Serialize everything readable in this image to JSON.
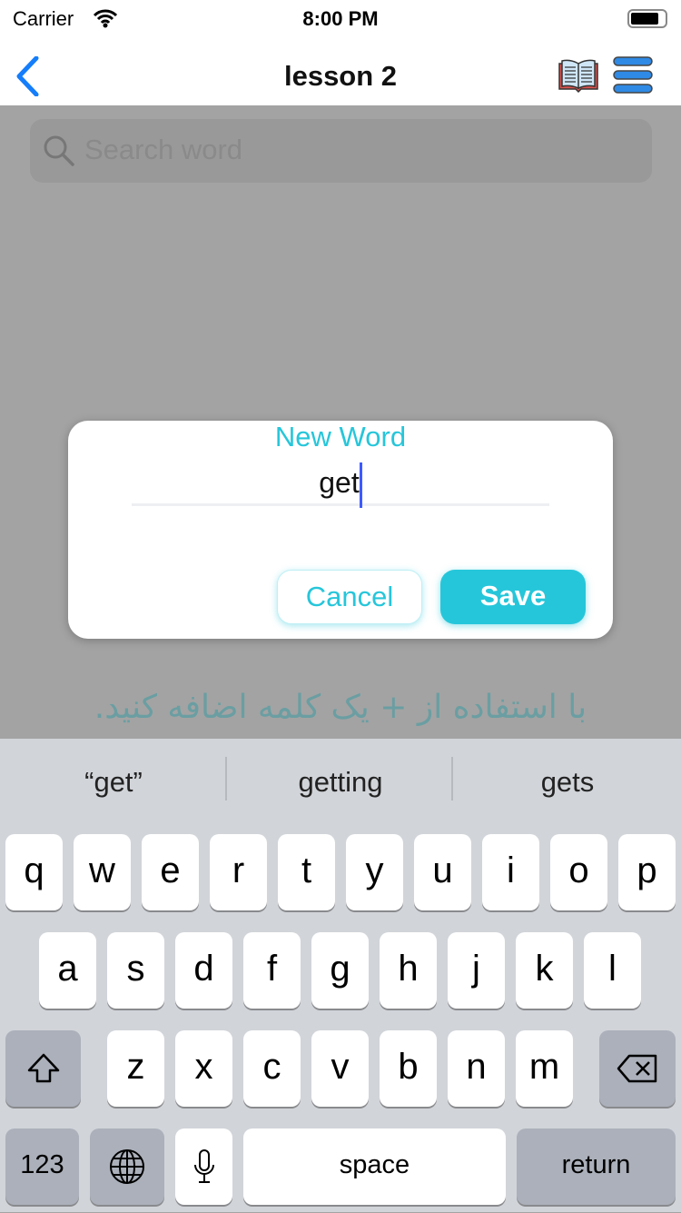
{
  "status": {
    "carrier": "Carrier",
    "time": "8:00 PM"
  },
  "nav": {
    "title": "lesson 2",
    "back_icon": "chevron-left-icon",
    "book_icon": "open-book-icon",
    "menu_icon": "hamburger-menu-icon"
  },
  "search": {
    "placeholder": "Search word"
  },
  "dialog": {
    "title": "New Word",
    "value": "get",
    "cancel": "Cancel",
    "save": "Save"
  },
  "hint": "با استفاده از + یک کلمه اضافه کنید.",
  "colors": {
    "accent": "#26c6da",
    "ios_blue": "#147efb"
  },
  "keyboard": {
    "suggestions": [
      "“get”",
      "getting",
      "gets"
    ],
    "row1": [
      "q",
      "w",
      "e",
      "r",
      "t",
      "y",
      "u",
      "i",
      "o",
      "p"
    ],
    "row2": [
      "a",
      "s",
      "d",
      "f",
      "g",
      "h",
      "j",
      "k",
      "l"
    ],
    "row3": [
      "z",
      "x",
      "c",
      "v",
      "b",
      "n",
      "m"
    ],
    "numbers": "123",
    "space": "space",
    "return": "return"
  }
}
